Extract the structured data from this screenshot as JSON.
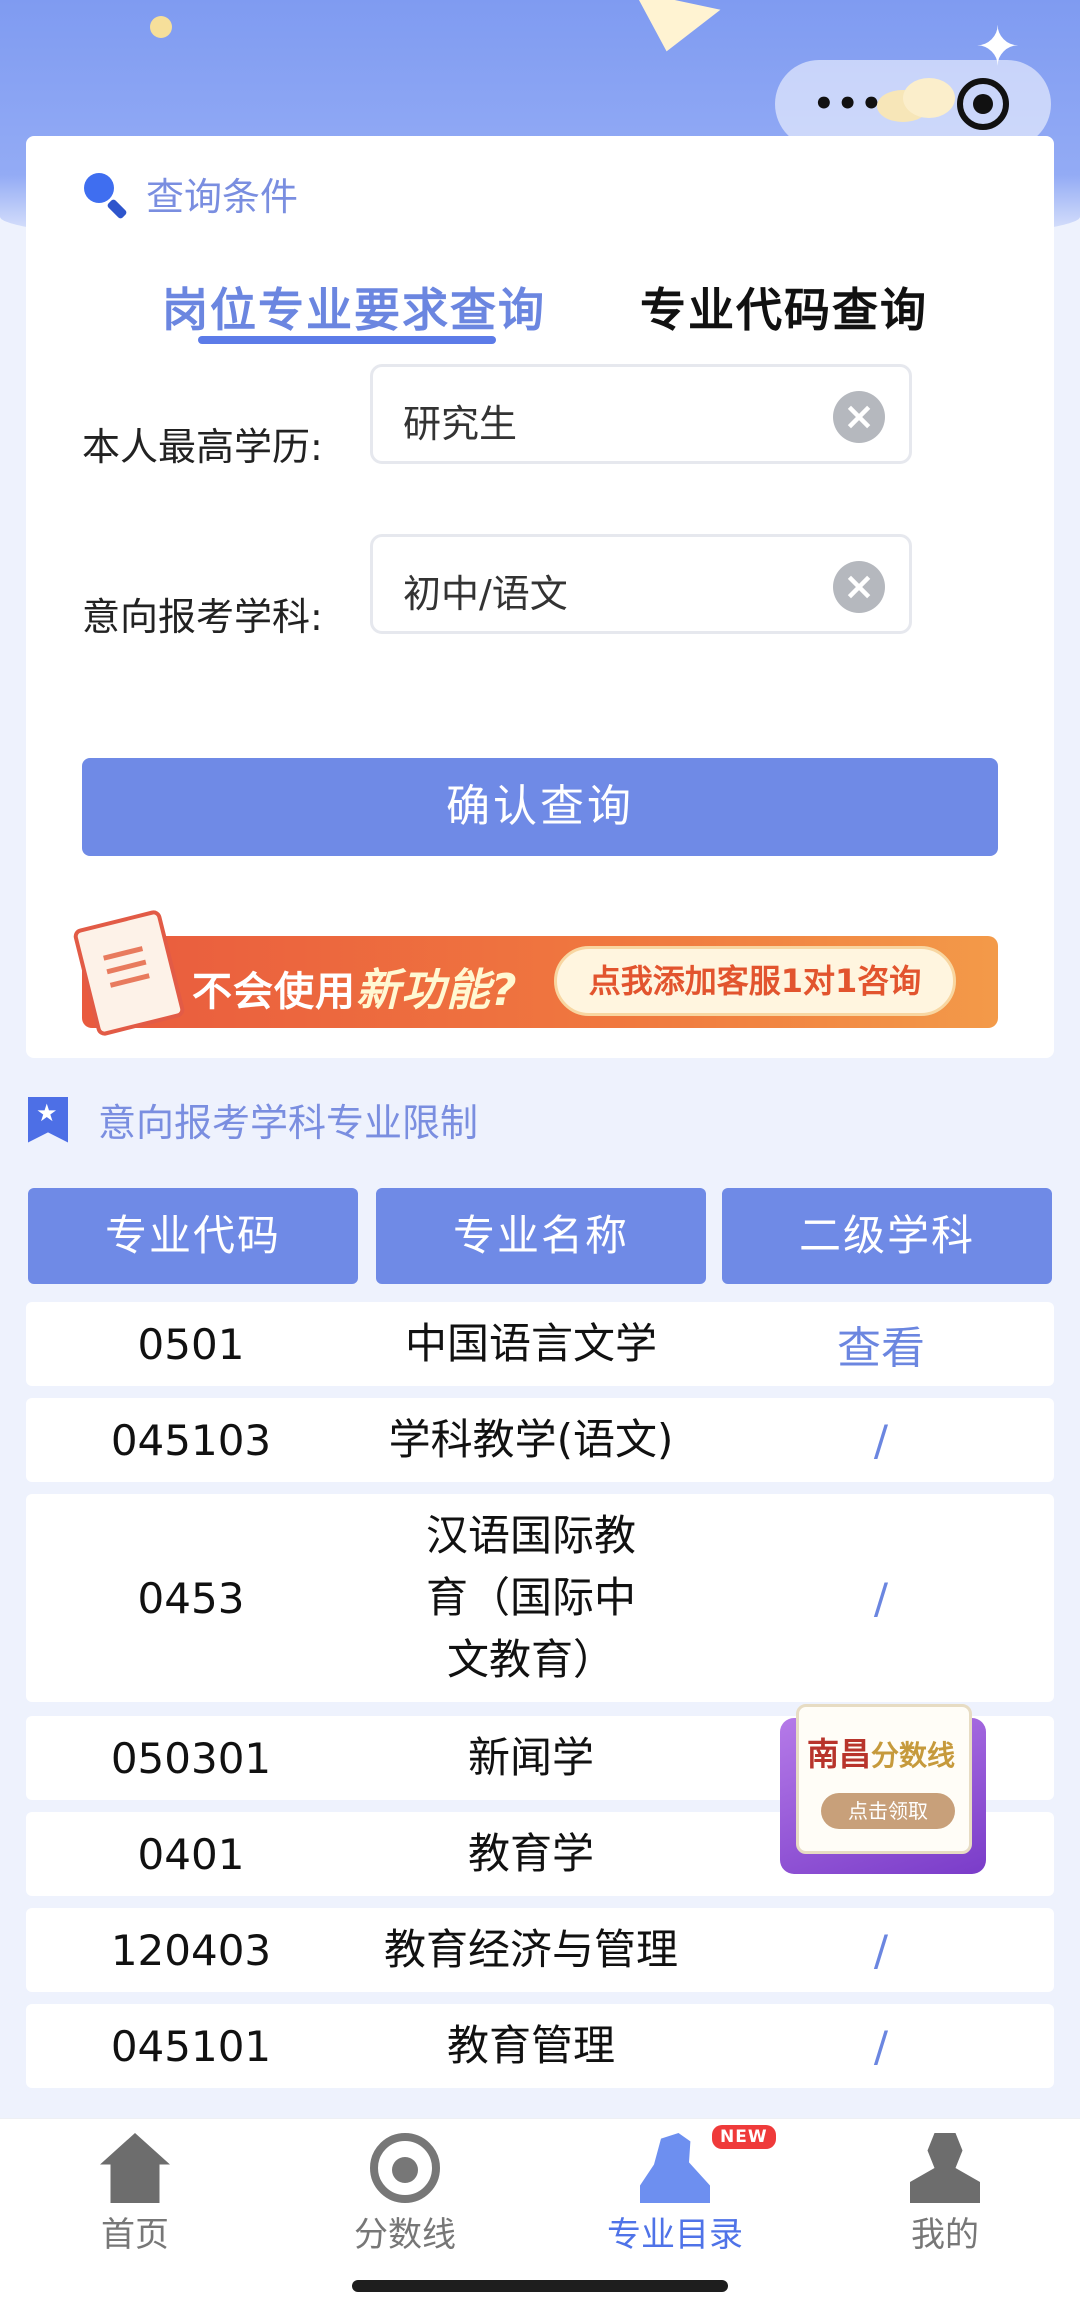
{
  "capsule": {
    "more_glyph": "•••"
  },
  "query_card": {
    "title": "查询条件",
    "tabs": [
      {
        "label": "岗位专业要求查询",
        "active": true
      },
      {
        "label": "专业代码查询",
        "active": false
      }
    ],
    "fields": [
      {
        "label": "本人最高学历:",
        "value": "研究生"
      },
      {
        "label": "意向报考学科:",
        "value": "初中/语文"
      }
    ],
    "confirm_label": "确认查询",
    "promo": {
      "text_prefix": "不会使用",
      "text_highlight": "新功能?",
      "pill": "点我添加客服1对1咨询"
    }
  },
  "restriction": {
    "title": "意向报考学科专业限制",
    "columns": [
      "专业代码",
      "专业名称",
      "二级学科"
    ],
    "rows": [
      {
        "code": "0501",
        "name": "中国语言文学",
        "sub": "查看"
      },
      {
        "code": "045103",
        "name": "学科教学(语文)",
        "sub": "/"
      },
      {
        "code": "0453",
        "name": "汉语国际教育（国际中文教育）",
        "sub": "/"
      },
      {
        "code": "050301",
        "name": "新闻学",
        "sub": ""
      },
      {
        "code": "0401",
        "name": "教育学",
        "sub": ""
      },
      {
        "code": "120403",
        "name": "教育经济与管理",
        "sub": "/"
      },
      {
        "code": "045101",
        "name": "教育管理",
        "sub": "/"
      }
    ]
  },
  "float_ad": {
    "city": "南昌",
    "title": "分数线",
    "button": "点击领取"
  },
  "bottom_nav": {
    "items": [
      {
        "label": "首页",
        "icon": "home-icon",
        "active": false
      },
      {
        "label": "分数线",
        "icon": "headset-icon",
        "active": false
      },
      {
        "label": "专业目录",
        "icon": "people-icon",
        "active": true,
        "badge": "NEW"
      },
      {
        "label": "我的",
        "icon": "user-icon",
        "active": false
      }
    ]
  },
  "colors": {
    "accent": "#6f8ae6",
    "active_text": "#4f73e8",
    "promo_orange": "#f0793f"
  }
}
